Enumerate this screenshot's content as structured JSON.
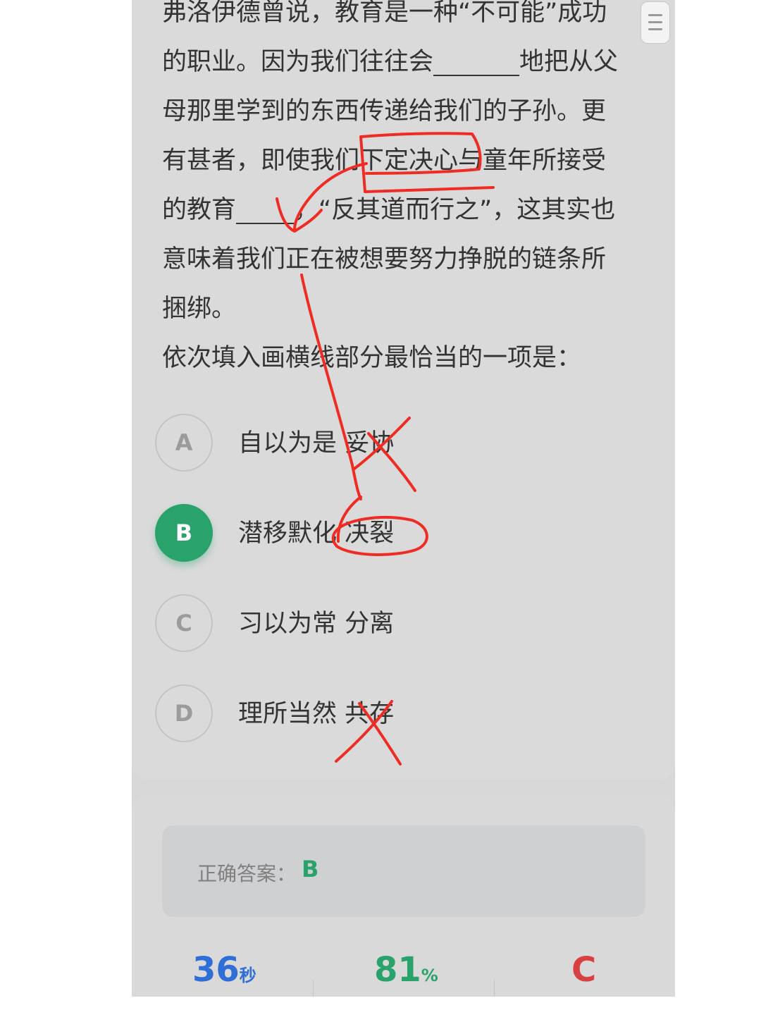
{
  "passage": {
    "line1": "弗洛伊德曾说，教育是一种“不可能”成功",
    "line2_a": "的职业。因为我们往往会",
    "line2_b": "地把从父",
    "line3": "母那里学到的东西传递给我们的子孙。更",
    "line4": "有甚者，即使我们下定决心与童年所接受",
    "line5_a": "的教育",
    "line5_b": "，“反其道而行之”，这其实也",
    "line6": "意味着我们正在被想要努力挣脱的链条所",
    "line7": "捆绑。",
    "prompt": "依次填入画横线部分最恰当的一项是："
  },
  "options": [
    {
      "letter": "A",
      "text": "自以为是  妥协",
      "selected": false
    },
    {
      "letter": "B",
      "text": "潜移默化  决裂",
      "selected": true
    },
    {
      "letter": "C",
      "text": "习以为常  分离",
      "selected": false
    },
    {
      "letter": "D",
      "text": "理所当然  共存",
      "selected": false
    }
  ],
  "answer": {
    "label": "正确答案：",
    "value": "B"
  },
  "stats": {
    "time_value": "36",
    "time_unit": "秒",
    "accuracy_value": "81",
    "accuracy_unit": "%",
    "grade": "C"
  },
  "colors": {
    "accent_green": "#29a36b",
    "time_blue": "#2d6fd6",
    "grade_red": "#d84141",
    "annotation_red": "#ee2c24"
  },
  "icons": {
    "menu": "menu-icon"
  }
}
